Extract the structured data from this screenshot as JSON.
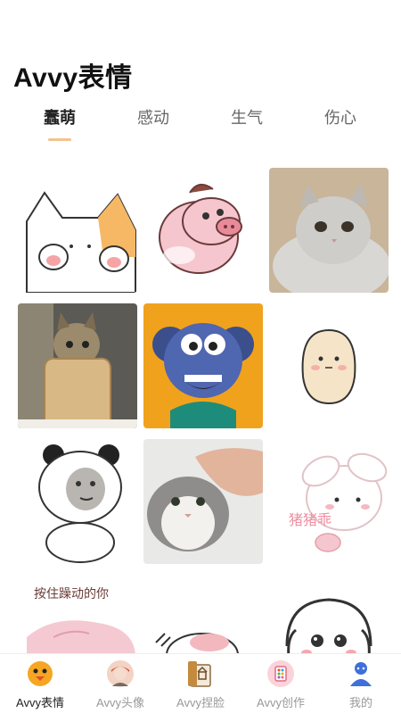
{
  "app_title": "Avvy表情",
  "tabs": [
    {
      "label": "蠢萌",
      "active": true
    },
    {
      "label": "感动",
      "active": false
    },
    {
      "label": "生气",
      "active": false
    },
    {
      "label": "伤心",
      "active": false
    }
  ],
  "tiles": [
    {
      "name": "cat-paws-sticker"
    },
    {
      "name": "pig-cartoon-sticker"
    },
    {
      "name": "grey-cat-photo"
    },
    {
      "name": "bread-cat-photo"
    },
    {
      "name": "blue-monkey-3d"
    },
    {
      "name": "egg-character-sticker"
    },
    {
      "name": "panda-face-sticker",
      "caption": "",
      "watermark": ""
    },
    {
      "name": "petted-cat-photo",
      "watermark": ""
    },
    {
      "name": "bunny-pig-sticker",
      "caption": "猪猪乖"
    },
    {
      "name": "hold-your-hand-sticker",
      "caption": "按住躁动的你"
    },
    {
      "name": "cat-doodle-sticker"
    },
    {
      "name": "crying-dog-sticker"
    }
  ],
  "bottom_nav": [
    {
      "label": "Avvy表情",
      "icon": "chick-face-icon",
      "active": true
    },
    {
      "label": "Avvy头像",
      "icon": "avatar-person-icon",
      "active": false
    },
    {
      "label": "Avvy捏脸",
      "icon": "face-edit-icon",
      "active": false
    },
    {
      "label": "Avvy创作",
      "icon": "create-palette-icon",
      "active": false
    },
    {
      "label": "我的",
      "icon": "profile-icon",
      "active": false
    }
  ],
  "colors": {
    "accent": "#f3c28f",
    "text_primary": "#111111",
    "text_muted": "#999999"
  }
}
